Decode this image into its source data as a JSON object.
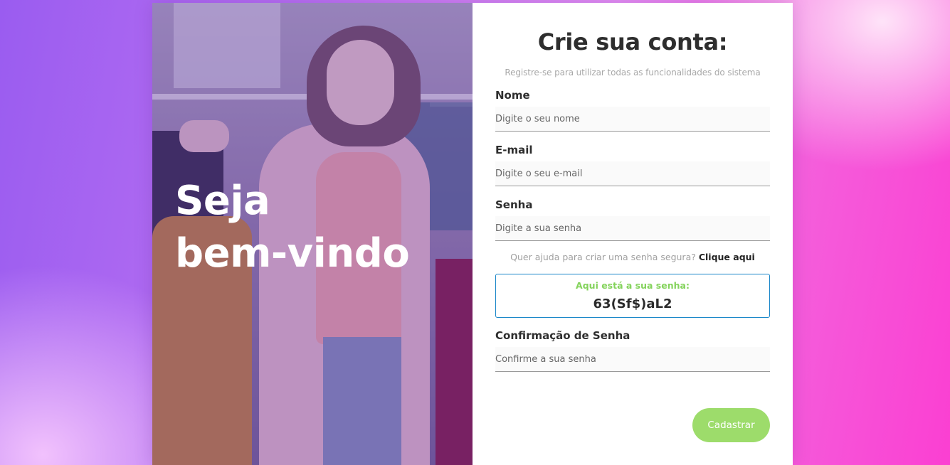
{
  "hero": {
    "line1": "Seja",
    "line2": "bem-vindo"
  },
  "form": {
    "title": "Crie sua conta:",
    "subtitle": "Registre-se para utilizar todas as funcionalidades do sistema",
    "name": {
      "label": "Nome",
      "placeholder": "Digite o seu nome"
    },
    "email": {
      "label": "E-mail",
      "placeholder": "Digite o seu e-mail"
    },
    "password": {
      "label": "Senha",
      "placeholder": "Digite a sua senha"
    },
    "help": {
      "text": "Quer ajuda para criar uma senha segura?",
      "link": "Clique aqui"
    },
    "generated": {
      "caption": "Aqui está a sua senha:",
      "value": "63(Sf$)aL2"
    },
    "confirm": {
      "label": "Confirmação de Senha",
      "placeholder": "Confirme a sua senha"
    },
    "submit_label": "Cadastrar"
  },
  "colors": {
    "accent_green": "#9ddc6b",
    "caption_green": "#84d35c",
    "box_border_blue": "#1b87c9"
  }
}
